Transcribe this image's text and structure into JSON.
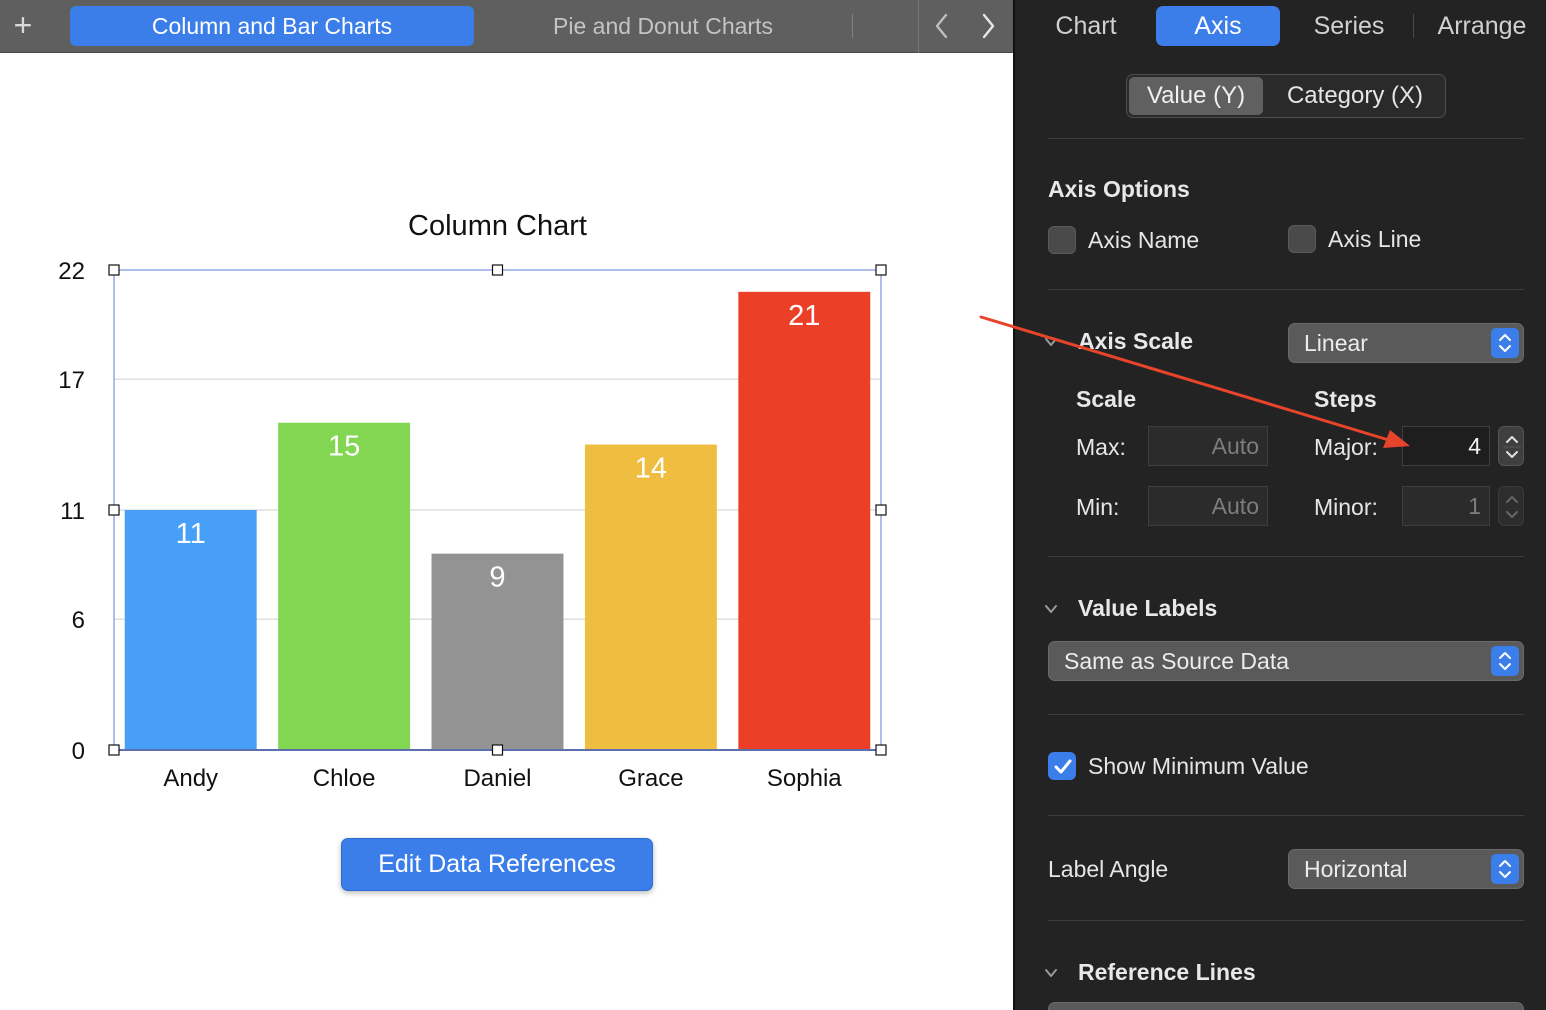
{
  "tabbar": {
    "plus_icon": "plus-icon",
    "tabs": [
      {
        "label": "Column and Bar Charts",
        "active": true
      },
      {
        "label": "Pie and Donut Charts",
        "active": false
      }
    ],
    "nav": {
      "prev_icon": "chevron-left-icon",
      "next_icon": "chevron-right-icon"
    }
  },
  "chart_data": {
    "type": "bar",
    "title": "Column Chart",
    "categories": [
      "Andy",
      "Chloe",
      "Daniel",
      "Grace",
      "Sophia"
    ],
    "values": [
      11,
      15,
      9,
      14,
      21
    ],
    "colors": [
      "#479ff8",
      "#82d652",
      "#939393",
      "#efbd40",
      "#ec3f27"
    ],
    "yticks": [
      0,
      6,
      11,
      17,
      22
    ],
    "ylim": [
      0,
      22
    ],
    "xlabel": "",
    "ylabel": "",
    "grid": true,
    "data_labels": true,
    "selected": true
  },
  "canvas": {
    "edit_button": "Edit Data References"
  },
  "sidebar": {
    "tabs": [
      {
        "label": "Chart",
        "active": false
      },
      {
        "label": "Axis",
        "active": true
      },
      {
        "label": "Series",
        "active": false
      },
      {
        "label": "Arrange",
        "active": false
      }
    ],
    "segment": {
      "value_label": "Value (Y)",
      "category_label": "Category (X)",
      "selected": "Value (Y)"
    },
    "axis_options": {
      "title": "Axis Options",
      "axis_name": {
        "label": "Axis Name",
        "checked": false
      },
      "axis_line": {
        "label": "Axis Line",
        "checked": false
      }
    },
    "axis_scale": {
      "title": "Axis Scale",
      "value": "Linear",
      "scale_title": "Scale",
      "steps_title": "Steps",
      "max_label": "Max:",
      "max_placeholder": "Auto",
      "min_label": "Min:",
      "min_placeholder": "Auto",
      "major_label": "Major:",
      "major_value": "4",
      "minor_label": "Minor:",
      "minor_value": "1"
    },
    "value_labels": {
      "title": "Value Labels",
      "value": "Same as Source Data"
    },
    "show_minimum": {
      "label": "Show Minimum Value",
      "checked": true
    },
    "label_angle": {
      "label": "Label Angle",
      "value": "Horizontal"
    },
    "reference_lines": {
      "title": "Reference Lines"
    }
  },
  "annotation": {
    "arrow_color": "#e8442b"
  }
}
